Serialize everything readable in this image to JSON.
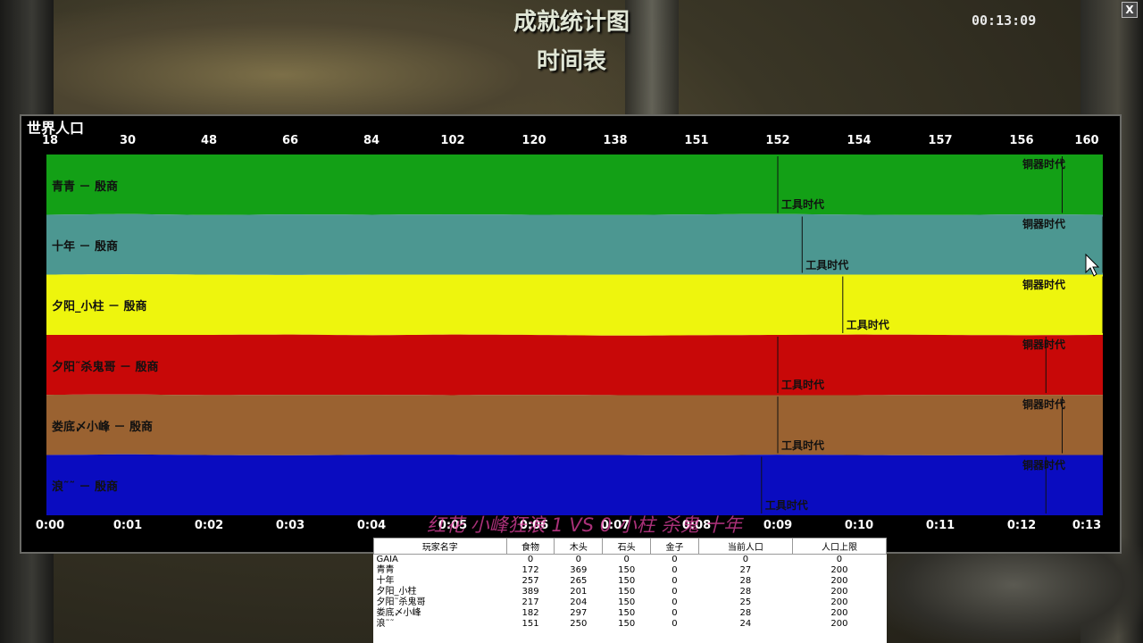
{
  "header": {
    "title": "成就统计图",
    "subtitle": "时间表",
    "clock": "00:13:09",
    "close_label": "X"
  },
  "chart_data": {
    "type": "area",
    "title": "世界人口",
    "x": [
      "0:00",
      "0:01",
      "0:02",
      "0:03",
      "0:04",
      "0:05",
      "0:06",
      "0:07",
      "0:08",
      "0:09",
      "0:10",
      "0:11",
      "0:12",
      "0:13"
    ],
    "world_population": [
      18,
      30,
      48,
      66,
      84,
      102,
      120,
      138,
      151,
      152,
      154,
      157,
      156,
      160
    ],
    "series": [
      {
        "name": "青青 － 殷商",
        "color": "#13a016",
        "age_markers": [
          {
            "label": "工具时代",
            "time": 9.0
          },
          {
            "label": "铜器时代",
            "time": 12.5
          }
        ]
      },
      {
        "name": "十年 － 殷商",
        "color": "#4c9791",
        "age_markers": [
          {
            "label": "工具时代",
            "time": 9.3
          },
          {
            "label": "铜器时代",
            "time": 13.0
          }
        ]
      },
      {
        "name": "夕阳_小柱 － 殷商",
        "color": "#eef50d",
        "age_markers": [
          {
            "label": "工具时代",
            "time": 9.8
          },
          {
            "label": "铜器时代",
            "time": 13.0
          }
        ]
      },
      {
        "name": "夕阳˜杀鬼哥 － 殷商",
        "color": "#c80808",
        "age_markers": [
          {
            "label": "工具时代",
            "time": 9.0
          },
          {
            "label": "铜器时代",
            "time": 12.3
          }
        ]
      },
      {
        "name": "娄底〆小峰 － 殷商",
        "color": "#9a6231",
        "age_markers": [
          {
            "label": "工具时代",
            "time": 9.0
          },
          {
            "label": "铜器时代",
            "time": 12.5
          }
        ]
      },
      {
        "name": "浪˜˜ － 殷商",
        "color": "#0a0cc0",
        "age_markers": [
          {
            "label": "工具时代",
            "time": 8.8
          },
          {
            "label": "铜器时代",
            "time": 12.3
          }
        ]
      }
    ],
    "share_percent": [
      [
        16.7,
        16.5,
        16.8,
        16.6,
        16.7,
        16.6,
        16.7,
        16.8,
        16.6,
        16.5,
        16.7,
        16.8,
        16.6,
        16.7
      ],
      [
        16.6,
        16.7,
        16.5,
        16.8,
        16.6,
        16.7,
        16.6,
        16.5,
        16.7,
        16.8,
        16.6,
        16.5,
        16.7,
        16.6
      ],
      [
        16.7,
        16.8,
        16.7,
        16.5,
        16.8,
        16.6,
        16.7,
        16.9,
        16.8,
        16.7,
        16.6,
        16.7,
        16.8,
        16.7
      ],
      [
        16.6,
        16.5,
        16.7,
        16.7,
        16.5,
        16.8,
        16.6,
        16.5,
        16.6,
        16.7,
        16.8,
        16.6,
        16.5,
        16.6
      ],
      [
        16.7,
        16.6,
        16.6,
        16.8,
        16.6,
        16.5,
        16.7,
        16.6,
        16.7,
        16.5,
        16.6,
        16.8,
        16.7,
        16.7
      ],
      [
        16.7,
        16.9,
        16.7,
        16.6,
        16.8,
        16.8,
        16.7,
        16.7,
        16.6,
        16.8,
        16.7,
        16.6,
        16.7,
        16.7
      ]
    ],
    "xlim": [
      0,
      13
    ],
    "ylim": [
      0,
      100
    ]
  },
  "overlay_caption": "红花 小峰狂浪 1 VS 0 小柱 杀鬼 十年",
  "stats": {
    "headers": [
      "玩家名字",
      "食物",
      "木头",
      "石头",
      "金子",
      "当前人口",
      "人口上限"
    ],
    "rows": [
      [
        "GAIA",
        "0",
        "0",
        "0",
        "0",
        "0",
        "0"
      ],
      [
        "青青",
        "172",
        "369",
        "150",
        "0",
        "27",
        "200"
      ],
      [
        "十年",
        "257",
        "265",
        "150",
        "0",
        "28",
        "200"
      ],
      [
        "夕阳_小柱",
        "389",
        "201",
        "150",
        "0",
        "28",
        "200"
      ],
      [
        "夕阳˜杀鬼哥",
        "217",
        "204",
        "150",
        "0",
        "25",
        "200"
      ],
      [
        "娄底〆小峰",
        "182",
        "297",
        "150",
        "0",
        "28",
        "200"
      ],
      [
        "浪˜˜",
        "151",
        "250",
        "150",
        "0",
        "24",
        "200"
      ]
    ]
  }
}
